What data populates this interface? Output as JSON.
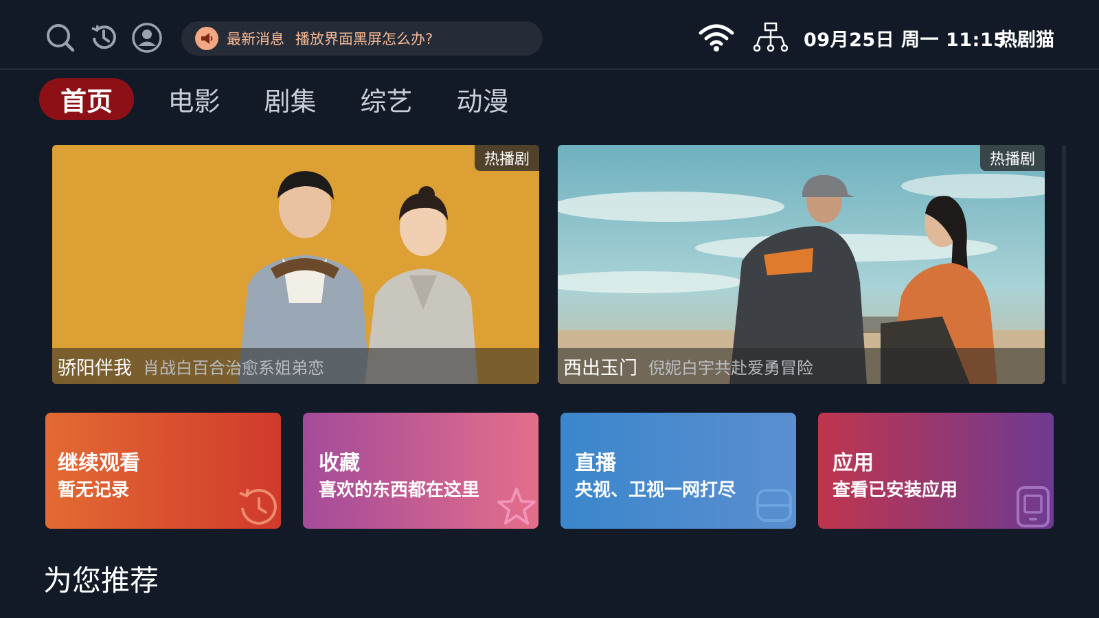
{
  "header": {
    "icons": [
      "search-icon",
      "history-icon",
      "user-icon"
    ],
    "notice": {
      "tag": "最新消息",
      "text": "播放界面黑屏怎么办?",
      "icon": "megaphone-icon"
    },
    "status_icons": [
      "wifi-icon",
      "network-icon"
    ],
    "datetime": "09月25日 周一 11:15",
    "brand": "热剧猫"
  },
  "tabs": [
    {
      "label": "首页",
      "active": true
    },
    {
      "label": "电影",
      "active": false
    },
    {
      "label": "剧集",
      "active": false
    },
    {
      "label": "综艺",
      "active": false
    },
    {
      "label": "动漫",
      "active": false
    }
  ],
  "banners": [
    {
      "badge": "热播剧",
      "title": "骄阳伴我",
      "subtitle": "肖战白百合治愈系姐弟恋"
    },
    {
      "badge": "热播剧",
      "title": "西出玉门",
      "subtitle": "倪妮白宇共赴爱勇冒险"
    }
  ],
  "cards": [
    {
      "title": "继续观看",
      "subtitle": "暂无记录",
      "icon": "history-icon",
      "gradient": [
        "#e36a33",
        "#d03a2c"
      ]
    },
    {
      "title": "收藏",
      "subtitle": "喜欢的东西都在这里",
      "icon": "star-icon",
      "gradient": [
        "#a34b9a",
        "#e46e8a"
      ]
    },
    {
      "title": "直播",
      "subtitle": "央视、卫视一网打尽",
      "icon": "tv-icon",
      "gradient": [
        "#3b86cc",
        "#5a8fd0"
      ]
    },
    {
      "title": "应用",
      "subtitle": "查看已安装应用",
      "icon": "tablet-icon",
      "gradient": [
        "#c0354e",
        "#6e3a92"
      ]
    }
  ],
  "section": {
    "title": "为您推荐"
  },
  "colors": {
    "background": "#121a27",
    "active_tab": "#8e1017",
    "notice_text": "#f4b792"
  }
}
